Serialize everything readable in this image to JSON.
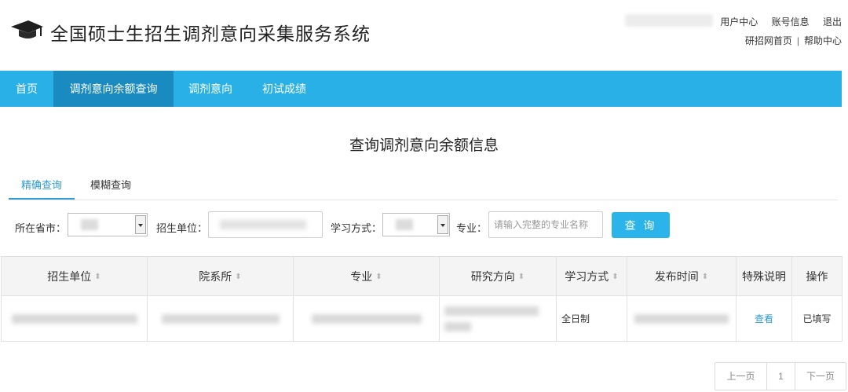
{
  "header": {
    "title": "全国硕士生招生调剂意向采集服务系统",
    "links_row1": [
      "用户中心",
      "账号信息",
      "退出"
    ],
    "links_row2": [
      "研招网首页",
      "帮助中心"
    ],
    "separator": "|"
  },
  "nav": {
    "items": [
      {
        "label": "首页",
        "active": false
      },
      {
        "label": "调剂意向余额查询",
        "active": true
      },
      {
        "label": "调剂意向",
        "active": false
      },
      {
        "label": "初试成绩",
        "active": false
      }
    ],
    "color": "#29b0e6",
    "active_color": "#1a8bc0"
  },
  "page": {
    "heading": "查询调剂意向余额信息"
  },
  "tabs": [
    {
      "label": "精确查询",
      "active": true
    },
    {
      "label": "模糊查询",
      "active": false
    }
  ],
  "filters": {
    "province_label": "所在省市：",
    "unit_label": "招生单位：",
    "study_mode_label": "学习方式：",
    "major_label": "专业：",
    "major_placeholder": "请输入完整的专业名称",
    "query_button": "查 询"
  },
  "table": {
    "headers": [
      "招生单位",
      "院系所",
      "专业",
      "研究方向",
      "学习方式",
      "发布时间",
      "特殊说明",
      "操作"
    ],
    "sortable": [
      true,
      true,
      true,
      true,
      true,
      true,
      false,
      false
    ],
    "rows": [
      {
        "study_mode": "全日制",
        "special_note": "查看",
        "operation": "已填写"
      }
    ]
  },
  "pager": {
    "prev": "上一页",
    "page": "1",
    "next": "下一页"
  },
  "icons": {
    "logo": "graduation-cap-icon",
    "sort": "sort-icon",
    "dropdown": "chevron-down-icon"
  }
}
